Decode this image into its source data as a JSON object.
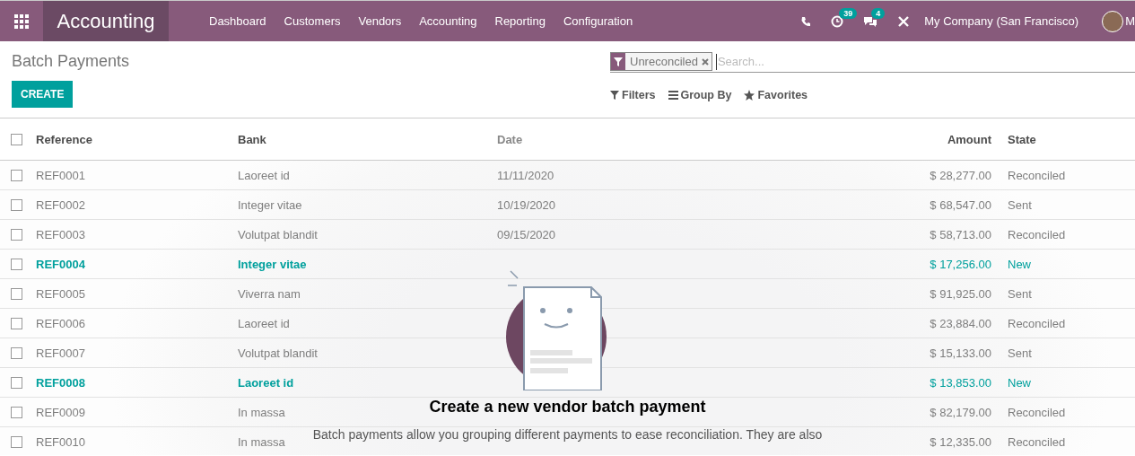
{
  "navbar": {
    "app_title": "Accounting",
    "menus": [
      "Dashboard",
      "Customers",
      "Vendors",
      "Accounting",
      "Reporting",
      "Configuration"
    ],
    "activity_count": "39",
    "message_count": "4",
    "company": "My Company (San Francisco)",
    "user": "M"
  },
  "control_panel": {
    "title": "Batch Payments",
    "create_button": "CREATE",
    "search": {
      "facet": "Unreconciled",
      "placeholder": "Search..."
    },
    "filters": "Filters",
    "group_by": "Group By",
    "favorites": "Favorites"
  },
  "table": {
    "all_selected": false,
    "columns": [
      "Reference",
      "Bank",
      "Date",
      "Amount",
      "State"
    ],
    "rows": [
      {
        "reference": "REF0001",
        "bank": "Laoreet id",
        "date": "11/11/2020",
        "amount": "$ 28,277.00",
        "state": "Reconciled",
        "highlighted": false,
        "checked": false
      },
      {
        "reference": "REF0002",
        "bank": "Integer vitae",
        "date": "10/19/2020",
        "amount": "$ 68,547.00",
        "state": "Sent",
        "highlighted": false,
        "checked": false
      },
      {
        "reference": "REF0003",
        "bank": "Volutpat blandit",
        "date": "09/15/2020",
        "amount": "$ 58,713.00",
        "state": "Reconciled",
        "highlighted": false,
        "checked": false
      },
      {
        "reference": "REF0004",
        "bank": "Integer vitae",
        "amount": "$ 17,256.00",
        "state": "New",
        "highlighted": true,
        "checked": false
      },
      {
        "reference": "REF0005",
        "bank": "Viverra nam",
        "amount": "$ 91,925.00",
        "state": "Sent",
        "highlighted": false,
        "checked": false
      },
      {
        "reference": "REF0006",
        "bank": "Laoreet id",
        "amount": "$ 23,884.00",
        "state": "Reconciled",
        "highlighted": false,
        "checked": false
      },
      {
        "reference": "REF0007",
        "bank": "Volutpat blandit",
        "amount": "$ 15,133.00",
        "state": "Sent",
        "highlighted": false,
        "checked": false
      },
      {
        "reference": "REF0008",
        "bank": "Laoreet id",
        "amount": "$ 13,853.00",
        "state": "New",
        "highlighted": true,
        "checked": false
      },
      {
        "reference": "REF0009",
        "bank": "In massa",
        "amount": "$ 82,179.00",
        "state": "Reconciled",
        "highlighted": false,
        "checked": false
      },
      {
        "reference": "REF0010",
        "bank": "In massa",
        "amount": "$ 12,335.00",
        "state": "Reconciled",
        "highlighted": false,
        "checked": false
      }
    ]
  },
  "empty_help": {
    "title": "Create a new vendor batch payment",
    "text": "Batch payments allow you grouping different payments to ease reconciliation. They are also"
  }
}
